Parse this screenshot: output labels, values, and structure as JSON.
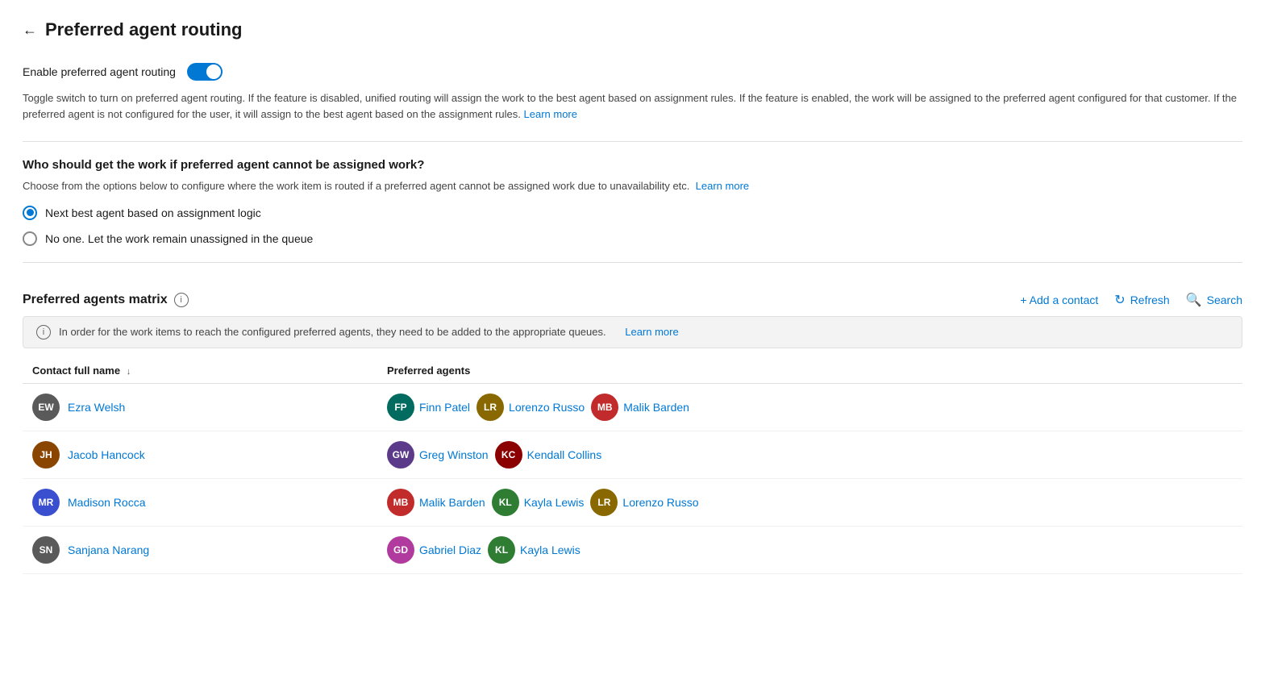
{
  "page": {
    "back_label": "←",
    "title": "Preferred agent routing"
  },
  "toggle_section": {
    "label": "Enable preferred agent routing",
    "enabled": true,
    "description": "Toggle switch to turn on preferred agent routing. If the feature is disabled, unified routing will assign the work to the best agent based on assignment rules. If the feature is enabled, the work will be assigned to the preferred agent configured for that customer. If the preferred agent is not configured for the user, it will assign to the best agent based on the assignment rules.",
    "learn_more": "Learn more"
  },
  "routing_section": {
    "heading": "Who should get the work if preferred agent cannot be assigned work?",
    "description": "Choose from the options below to configure where the work item is routed if a preferred agent cannot be assigned work due to unavailability etc.",
    "learn_more": "Learn more",
    "options": [
      {
        "id": "next-best",
        "label": "Next best agent based on assignment logic",
        "selected": true
      },
      {
        "id": "no-one",
        "label": "No one. Let the work remain unassigned in the queue",
        "selected": false
      }
    ]
  },
  "matrix_section": {
    "title": "Preferred agents matrix",
    "info_icon": "i",
    "actions": {
      "add_contact": "+ Add a contact",
      "refresh": "Refresh",
      "search": "Search"
    },
    "banner_text": "In order for the work items to reach the configured preferred agents, they need to be added to the appropriate queues.",
    "banner_learn_more": "Learn more",
    "table": {
      "columns": [
        {
          "label": "Contact full name",
          "sort": "↓"
        },
        {
          "label": "Preferred agents"
        }
      ],
      "rows": [
        {
          "contact": {
            "initials": "EW",
            "name": "Ezra Welsh",
            "color": "#5a5a5a"
          },
          "agents": [
            {
              "initials": "FP",
              "name": "Finn Patel",
              "color": "#006b5e"
            },
            {
              "initials": "LR",
              "name": "Lorenzo Russo",
              "color": "#8a6800"
            },
            {
              "initials": "MB",
              "name": "Malik Barden",
              "color": "#c22b2b"
            }
          ]
        },
        {
          "contact": {
            "initials": "JH",
            "name": "Jacob Hancock",
            "color": "#8a4500"
          },
          "agents": [
            {
              "initials": "GW",
              "name": "Greg Winston",
              "color": "#5c3a8a"
            },
            {
              "initials": "KC",
              "name": "Kendall Collins",
              "color": "#8b0000"
            }
          ]
        },
        {
          "contact": {
            "initials": "MR",
            "name": "Madison Rocca",
            "color": "#3a4fcf"
          },
          "agents": [
            {
              "initials": "MB",
              "name": "Malik Barden",
              "color": "#c22b2b"
            },
            {
              "initials": "KL",
              "name": "Kayla Lewis",
              "color": "#2e7d32"
            },
            {
              "initials": "LR",
              "name": "Lorenzo Russo",
              "color": "#8a6800"
            }
          ]
        },
        {
          "contact": {
            "initials": "SN",
            "name": "Sanjana Narang",
            "color": "#5a5a5a"
          },
          "agents": [
            {
              "initials": "GD",
              "name": "Gabriel Diaz",
              "color": "#b03a9e"
            },
            {
              "initials": "KL",
              "name": "Kayla Lewis",
              "color": "#2e7d32"
            }
          ]
        }
      ]
    }
  }
}
